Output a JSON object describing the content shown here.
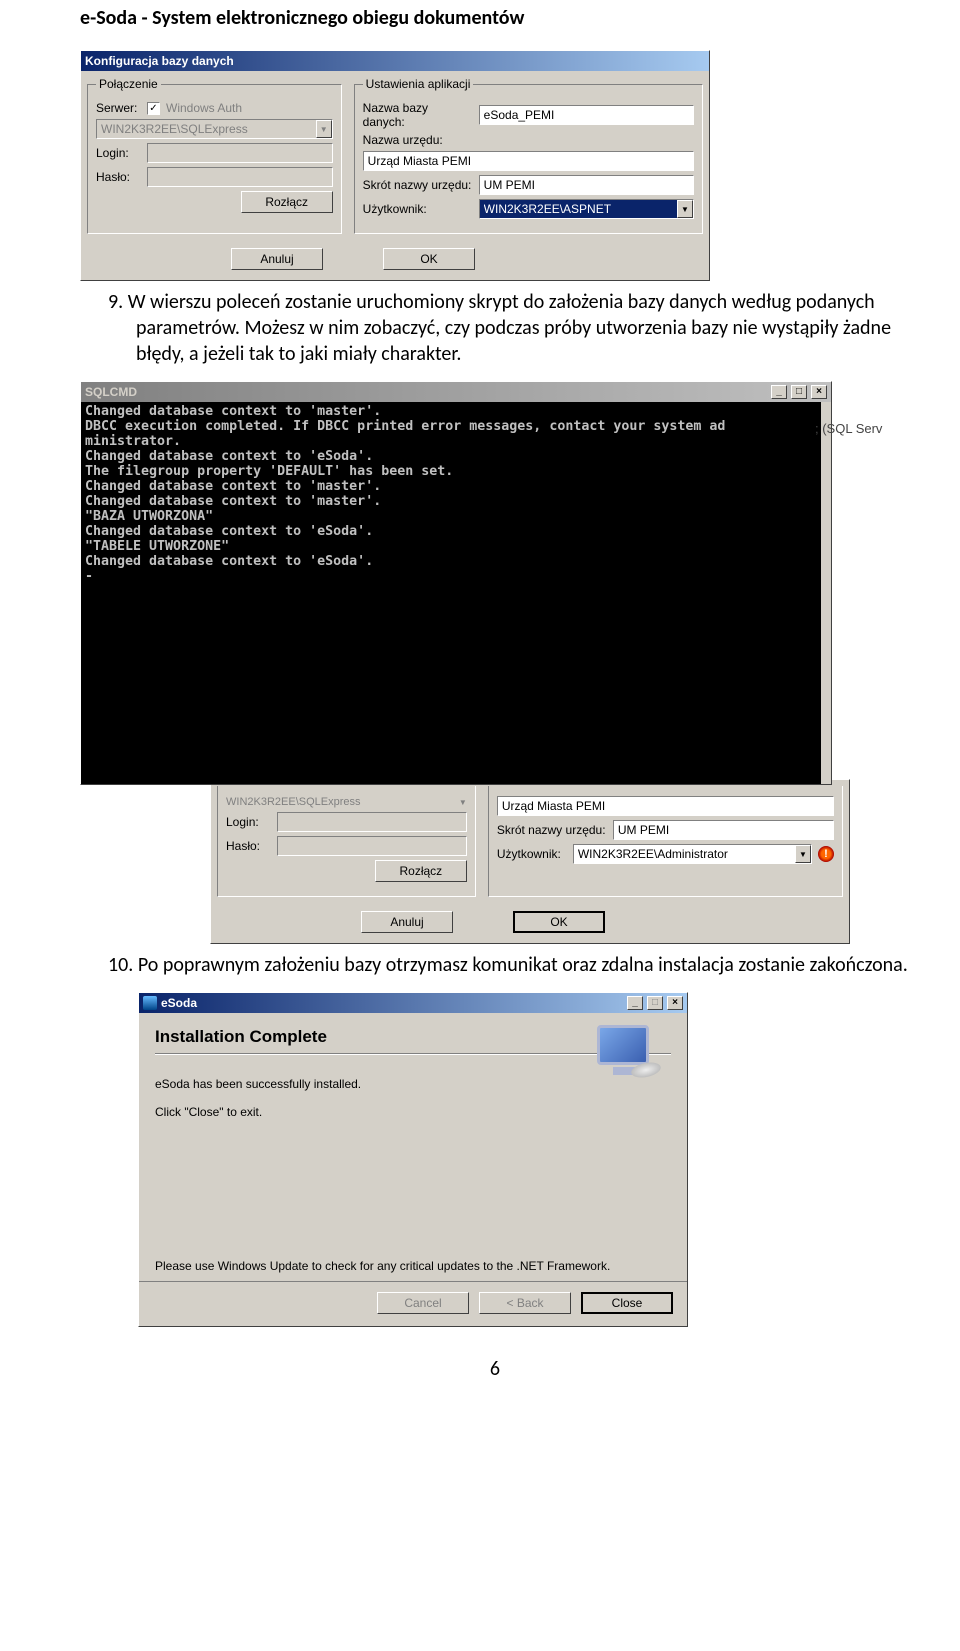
{
  "doc_header": "e-Soda - System elektronicznego obiegu dokumentów",
  "para9": "9.  W wierszu poleceń zostanie uruchomiony skrypt do założenia bazy danych według podanych parametrów. Możesz w nim zobaczyć, czy podczas próby utworzenia bazy nie wystąpiły żadne błędy, a jeżeli tak to jaki miały charakter.",
  "para10": "10. Po poprawnym założeniu bazy otrzymasz komunikat oraz zdalna instalacja zostanie zakończona.",
  "page_number": "6",
  "config1": {
    "title": "Konfiguracja bazy danych",
    "group_conn": "Połączenie",
    "group_app": "Ustawienia aplikacji",
    "server_label": "Serwer:",
    "server_value": "WIN2K3R2EE\\SQLExpress",
    "winauth_label": "Windows Auth",
    "winauth_checked": "✓",
    "login_label": "Login:",
    "haslo_label": "Hasło:",
    "rozlacz": "Rozłącz",
    "dbname_label": "Nazwa bazy danych:",
    "dbname_value": "eSoda_PEMI",
    "urzad_label": "Nazwa urzędu:",
    "urzad_value": "Urząd Miasta PEMI",
    "skrot_label": "Skrót nazwy urzędu:",
    "skrot_value": "UM PEMI",
    "user_label": "Użytkownik:",
    "user_value": "WIN2K3R2EE\\ASPNET",
    "anuluj": "Anuluj",
    "ok": "OK"
  },
  "sqlcmd": {
    "title": "SQLCMD",
    "lines": "Changed database context to 'master'.\nDBCC execution completed. If DBCC printed error messages, contact your system ad\nministrator.\nChanged database context to 'eSoda'.\nThe filegroup property 'DEFAULT' has been set.\nChanged database context to 'master'.\nChanged database context to 'master'.\n\"BAZA UTWORZONA\"\nChanged database context to 'eSoda'.\n\"TABELE UTWORZONE\"\nChanged database context to 'eSoda'.\n-",
    "behind_text": "; (SQL Serv"
  },
  "config2": {
    "server_value": "WIN2K3R2EE\\SQLExpress",
    "login_label": "Login:",
    "haslo_label": "Hasło:",
    "rozlacz": "Rozłącz",
    "urzad_value": "Urząd Miasta PEMI",
    "skrot_label": "Skrót nazwy urzędu:",
    "skrot_value": "UM PEMI",
    "user_label": "Użytkownik:",
    "user_value": "WIN2K3R2EE\\Administrator",
    "anuluj": "Anuluj",
    "ok": "OK"
  },
  "wizard": {
    "title": "eSoda",
    "heading": "Installation Complete",
    "line1": "eSoda has been successfully installed.",
    "line2": "Click \"Close\" to exit.",
    "line3": "Please use Windows Update to check for any critical updates to the .NET Framework.",
    "cancel": "Cancel",
    "back": "< Back",
    "close": "Close"
  }
}
